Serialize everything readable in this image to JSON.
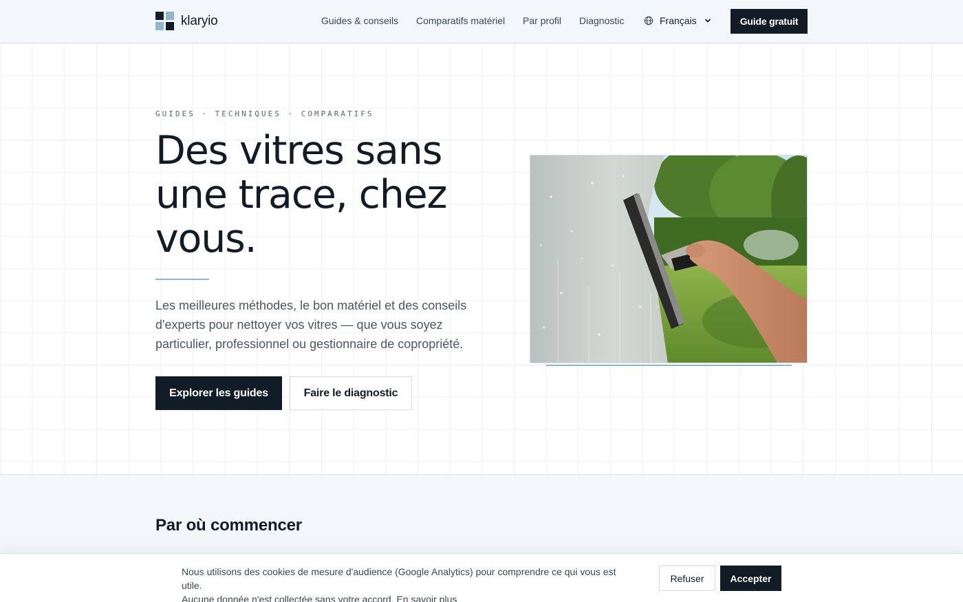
{
  "header": {
    "logo_text": "klaryio",
    "nav": [
      {
        "label": "Guides & conseils"
      },
      {
        "label": "Comparatifs matériel"
      },
      {
        "label": "Par profil"
      },
      {
        "label": "Diagnostic"
      }
    ],
    "language": "Français",
    "cta": "Guide gratuit"
  },
  "hero": {
    "eyebrow": "GUIDES · TECHNIQUES · COMPARATIFS",
    "title": "Des vitres sans une trace, chez vous.",
    "description": "Les meilleures méthodes, le bon matériel et des conseils d'experts pour nettoyer vos vitres — que vous soyez particulier, professionnel ou gestionnaire de copropriété.",
    "primary_button": "Explorer les guides",
    "secondary_button": "Faire le diagnostic"
  },
  "section": {
    "title": "Par où commencer"
  },
  "cookie_banner": {
    "text_line1": "Nous utilisons des cookies de mesure d'audience (Google Analytics) pour comprendre ce qui vous est utile.",
    "text_line2": "Aucune donnée n'est collectée sans votre accord.",
    "link": "En savoir plus",
    "refuse": "Refuser",
    "accept": "Accepter"
  },
  "colors": {
    "primary_dark": "#121c26",
    "accent": "#8fb6c9",
    "background_light": "#f4f7f9"
  },
  "icons": [
    "globe-icon",
    "chevron-down-icon",
    "logo-mark"
  ]
}
